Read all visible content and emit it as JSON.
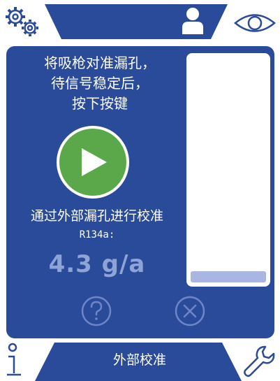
{
  "header": {
    "settings_icon": "gears-icon",
    "user_icon": "user-icon",
    "view_icon": "eye-icon"
  },
  "main": {
    "instruction_lines": [
      "将吸枪对准漏孔，",
      "待信号稳定后，",
      "按下按键"
    ],
    "start_icon": "play-icon",
    "method_label": "通过外部漏孔进行校准",
    "gas_label": "R134a:",
    "leak_rate": "4.3 g/a",
    "signal_level": 0.05,
    "help_icon": "question-icon",
    "cancel_icon": "cancel-x-icon"
  },
  "footer": {
    "info_icon": "info-icon",
    "title": "外部校准",
    "tools_icon": "wrench-icon"
  },
  "colors": {
    "panel": "#2a4a9a",
    "start_button": "#5aa84a",
    "value_text": "#8ea3d8",
    "level_fill": "#a9b6e4"
  }
}
